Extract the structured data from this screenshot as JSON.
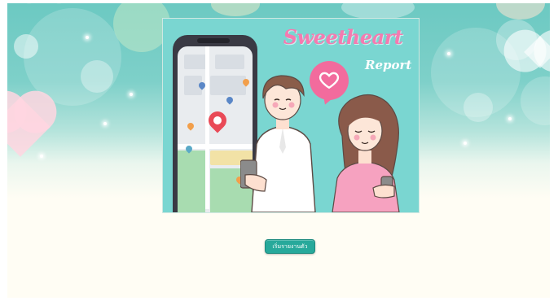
{
  "poster": {
    "title": "Sweetheart",
    "subtitle": "Report"
  },
  "actions": {
    "report_button_label": "เริ่มรายงานตัว"
  },
  "icons": {
    "map_pin": "map-pin-icon",
    "heart": "heart-icon"
  },
  "colors": {
    "page_background": "#fffdf4",
    "hero_teal": "#7ed0c9",
    "poster_background": "#7ad6d1",
    "title_pink": "#f47bb0",
    "button_teal": "#27a99b"
  }
}
